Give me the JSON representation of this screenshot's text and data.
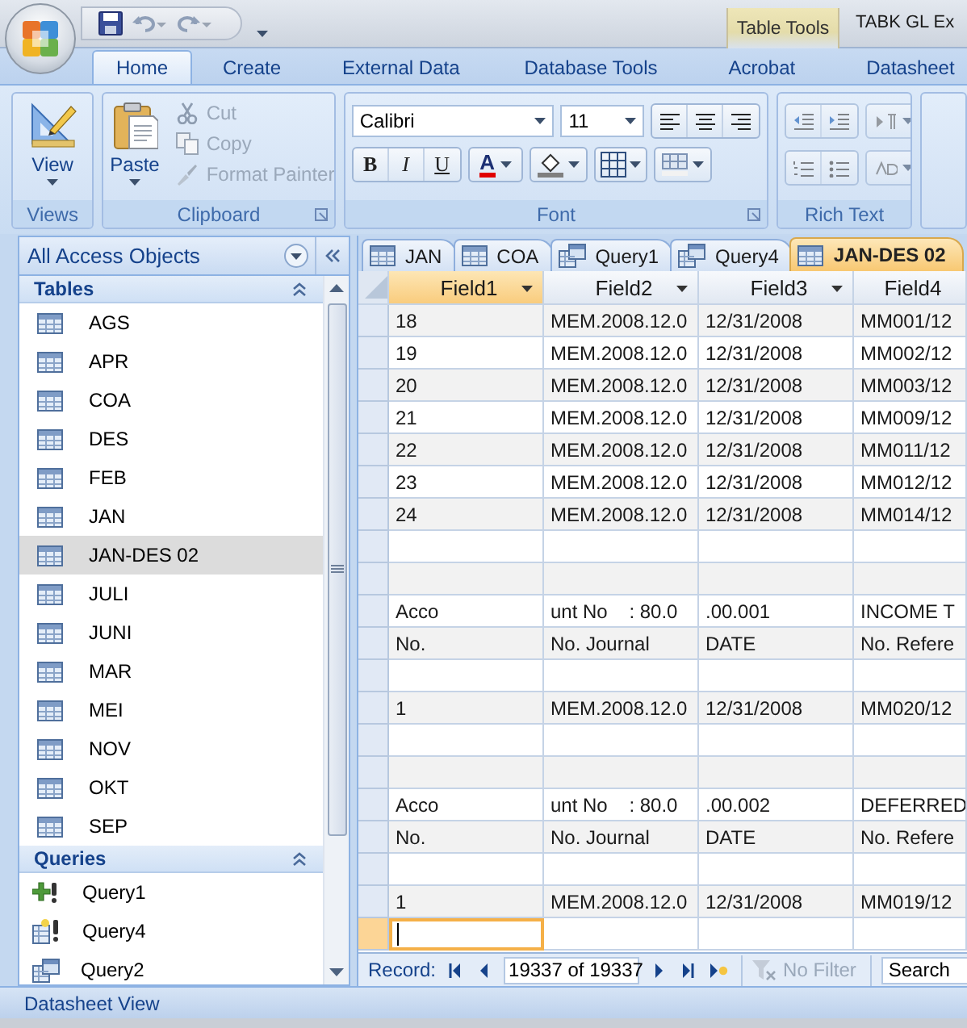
{
  "title_bar": {
    "contextual_tab": "Table Tools",
    "title": "TABK GL Ex"
  },
  "ribbon": {
    "tabs": [
      {
        "label": "Home",
        "selected": true
      },
      {
        "label": "Create",
        "selected": false
      },
      {
        "label": "External Data",
        "selected": false
      },
      {
        "label": "Database Tools",
        "selected": false
      },
      {
        "label": "Acrobat",
        "selected": false
      },
      {
        "label": "Datasheet",
        "selected": false
      }
    ],
    "views": {
      "button": "View",
      "label": "Views"
    },
    "clipboard": {
      "paste": "Paste",
      "label": "Clipboard",
      "commands": [
        {
          "label": "Cut",
          "kind": "cut",
          "disabled": true
        },
        {
          "label": "Copy",
          "kind": "copy",
          "disabled": true
        },
        {
          "label": "Format Painter",
          "kind": "painter",
          "disabled": true
        }
      ]
    },
    "font": {
      "font_name": "Calibri",
      "font_size": "11",
      "label": "Font",
      "format_buttons": [
        {
          "label": "B",
          "kind": "bold"
        },
        {
          "label": "I",
          "kind": "italic"
        },
        {
          "label": "U",
          "kind": "underline"
        }
      ],
      "font_color": "A"
    },
    "rich_text": {
      "label": "Rich Text"
    }
  },
  "navigation": {
    "title": "All Access Objects",
    "groups": [
      {
        "title": "Tables",
        "expanded": true,
        "items": [
          {
            "label": "AGS",
            "kind": "table",
            "selected": false
          },
          {
            "label": "APR",
            "kind": "table",
            "selected": false
          },
          {
            "label": "COA",
            "kind": "table",
            "selected": false
          },
          {
            "label": "DES",
            "kind": "table",
            "selected": false
          },
          {
            "label": "FEB",
            "kind": "table",
            "selected": false
          },
          {
            "label": "JAN",
            "kind": "table",
            "selected": false
          },
          {
            "label": "JAN-DES 02",
            "kind": "table",
            "selected": true
          },
          {
            "label": "JULI",
            "kind": "table",
            "selected": false
          },
          {
            "label": "JUNI",
            "kind": "table",
            "selected": false
          },
          {
            "label": "MAR",
            "kind": "table",
            "selected": false
          },
          {
            "label": "MEI",
            "kind": "table",
            "selected": false
          },
          {
            "label": "NOV",
            "kind": "table",
            "selected": false
          },
          {
            "label": "OKT",
            "kind": "table",
            "selected": false
          },
          {
            "label": "SEP",
            "kind": "table",
            "selected": false
          }
        ]
      },
      {
        "title": "Queries",
        "expanded": true,
        "items": [
          {
            "label": "Query1",
            "kind": "append",
            "selected": false
          },
          {
            "label": "Query4",
            "kind": "make-table",
            "selected": false
          },
          {
            "label": "Query2",
            "kind": "select",
            "selected": false
          }
        ]
      }
    ]
  },
  "datasheet": {
    "tabs": [
      {
        "label": "JAN",
        "kind": "table",
        "selected": false
      },
      {
        "label": "COA",
        "kind": "table",
        "selected": false
      },
      {
        "label": "Query1",
        "kind": "query",
        "selected": false
      },
      {
        "label": "Query4",
        "kind": "query",
        "selected": false
      },
      {
        "label": "JAN-DES 02",
        "kind": "table",
        "selected": true
      }
    ],
    "columns": [
      {
        "label": "Field1",
        "selected": true,
        "sort_menu": true
      },
      {
        "label": "Field2",
        "selected": false,
        "sort_menu": true
      },
      {
        "label": "Field3",
        "selected": false,
        "sort_menu": true
      },
      {
        "label": "Field4",
        "selected": false,
        "sort_menu": false
      }
    ],
    "rows": [
      {
        "kind": "data",
        "selected": false,
        "cells": [
          "18",
          "MEM.2008.12.0",
          "12/31/2008",
          "MM001/12"
        ]
      },
      {
        "kind": "data",
        "selected": false,
        "cells": [
          "19",
          "MEM.2008.12.0",
          "12/31/2008",
          "MM002/12"
        ]
      },
      {
        "kind": "data",
        "selected": false,
        "cells": [
          "20",
          "MEM.2008.12.0",
          "12/31/2008",
          "MM003/12"
        ]
      },
      {
        "kind": "data",
        "selected": false,
        "cells": [
          "21",
          "MEM.2008.12.0",
          "12/31/2008",
          "MM009/12"
        ]
      },
      {
        "kind": "data",
        "selected": false,
        "cells": [
          "22",
          "MEM.2008.12.0",
          "12/31/2008",
          "MM011/12"
        ]
      },
      {
        "kind": "data",
        "selected": false,
        "cells": [
          "23",
          "MEM.2008.12.0",
          "12/31/2008",
          "MM012/12"
        ]
      },
      {
        "kind": "data",
        "selected": false,
        "cells": [
          "24",
          "MEM.2008.12.0",
          "12/31/2008",
          "MM014/12"
        ]
      },
      {
        "kind": "blank",
        "selected": false
      },
      {
        "kind": "blank",
        "selected": false
      },
      {
        "kind": "data",
        "selected": false,
        "cells": [
          "Acco",
          "unt No    : 80.0",
          ".00.001",
          "INCOME T"
        ]
      },
      {
        "kind": "data",
        "selected": false,
        "cells": [
          "No.",
          "No. Journal",
          "DATE",
          "No. Refere"
        ]
      },
      {
        "kind": "blank",
        "selected": false
      },
      {
        "kind": "data",
        "selected": false,
        "cells": [
          "1",
          "MEM.2008.12.0",
          "12/31/2008",
          "MM020/12"
        ]
      },
      {
        "kind": "blank",
        "selected": false
      },
      {
        "kind": "blank",
        "selected": false
      },
      {
        "kind": "data",
        "selected": false,
        "cells": [
          "Acco",
          "unt No    : 80.0",
          ".00.002",
          "DEFERRED"
        ]
      },
      {
        "kind": "data",
        "selected": false,
        "cells": [
          "No.",
          "No. Journal",
          "DATE",
          "No. Refere"
        ]
      },
      {
        "kind": "blank",
        "selected": false
      },
      {
        "kind": "data",
        "selected": false,
        "cells": [
          "1",
          "MEM.2008.12.0",
          "12/31/2008",
          "MM019/12"
        ]
      },
      {
        "kind": "new",
        "selected": true
      }
    ]
  },
  "record_navigator": {
    "label": "Record:",
    "position": "19337 of 19337",
    "filter": {
      "label": "No Filter",
      "disabled": true
    },
    "search": {
      "placeholder": "Search"
    }
  },
  "status_bar": {
    "text": "Datasheet View"
  }
}
